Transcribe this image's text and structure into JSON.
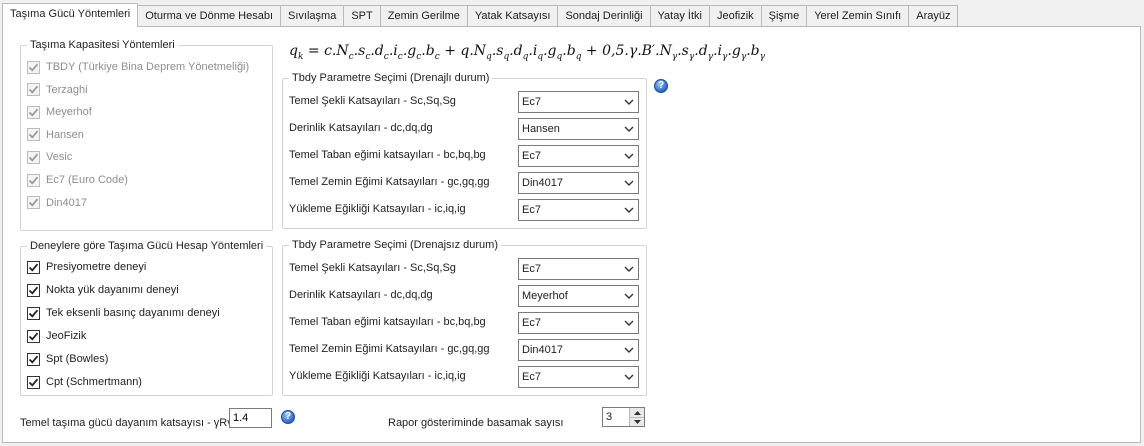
{
  "tabs": [
    {
      "label": "Taşıma Gücü Yöntemleri",
      "active": true
    },
    {
      "label": "Oturma ve Dönme Hesabı"
    },
    {
      "label": "Sıvılaşma"
    },
    {
      "label": "SPT"
    },
    {
      "label": "Zemin Gerilme"
    },
    {
      "label": "Yatak Katsayısı"
    },
    {
      "label": "Sondaj Derinliği"
    },
    {
      "label": "Yatay İtki"
    },
    {
      "label": "Jeofizik"
    },
    {
      "label": "Şişme"
    },
    {
      "label": "Yerel Zemin Sınıfı"
    },
    {
      "label": "Arayüz"
    }
  ],
  "capacity_methods": {
    "title": "Taşıma Kapasitesi Yöntemleri",
    "items": [
      {
        "label": "TBDY (Türkiye Bina Deprem Yönetmeliği)",
        "checked": true
      },
      {
        "label": "Terzaghi",
        "checked": true
      },
      {
        "label": "Meyerhof",
        "checked": true
      },
      {
        "label": "Hansen",
        "checked": true
      },
      {
        "label": "Vesic",
        "checked": true
      },
      {
        "label": "Ec7 (Euro Code)",
        "checked": true
      },
      {
        "label": "Din4017",
        "checked": true
      }
    ]
  },
  "test_methods": {
    "title": "Deneylere göre Taşıma Gücü Hesap Yöntemleri",
    "items": [
      {
        "label": "Presiyometre deneyi",
        "checked": true
      },
      {
        "label": "Nokta yük dayanımı deneyi",
        "checked": true
      },
      {
        "label": "Tek eksenli basınç dayanımı deneyi",
        "checked": true
      },
      {
        "label": "JeoFizik",
        "checked": true
      },
      {
        "label": "Spt (Bowles)",
        "checked": true
      },
      {
        "label": "Cpt (Schmertmann)",
        "checked": true
      }
    ]
  },
  "drained": {
    "title": "Tbdy Parametre Seçimi (Drenajlı durum)",
    "rows": [
      {
        "label": "Temel Şekli Katsayıları - Sc,Sq,Sg",
        "value": "Ec7"
      },
      {
        "label": "Derinlik Katsayıları - dc,dq,dg",
        "value": "Hansen"
      },
      {
        "label": "Temel Taban eğimi katsayıları - bc,bq,bg",
        "value": "Ec7"
      },
      {
        "label": "Temel Zemin Eğimi Katsayıları - gc,gq,gg",
        "value": "Din4017"
      },
      {
        "label": "Yükleme Eğikliği Katsayıları - ic,iq,ig",
        "value": "Ec7"
      }
    ]
  },
  "undrained": {
    "title": "Tbdy Parametre Seçimi  (Drenajsız durum)",
    "rows": [
      {
        "label": "Temel Şekli Katsayıları - Sc,Sq,Sg",
        "value": "Ec7"
      },
      {
        "label": "Derinlik Katsayıları - dc,dq,dg",
        "value": "Meyerhof"
      },
      {
        "label": "Temel Taban eğimi katsayıları - bc,bq,bg",
        "value": "Ec7"
      },
      {
        "label": "Temel Zemin Eğimi Katsayıları - gc,gq,gg",
        "value": "Din4017"
      },
      {
        "label": "Yükleme Eğikliği Katsayıları - ic,iq,ig",
        "value": "Ec7"
      }
    ]
  },
  "formula": {
    "lhs": "q",
    "lhs_sub": "k",
    "rhs": "= c.N_c.s_c.d_c.i_c.g_c.b_c + q.N_q.s_q.d_q.i_q.g_q.b_q + 0,5.γ.B′.N_γ.s_γ.d_γ.i_γ.g_γ.b_γ"
  },
  "bottom": {
    "resistance_label": "Temel taşıma gücü dayanım katsayısı - γRv",
    "resistance_value": "1.4",
    "digits_label": "Rapor gösteriminde basamak sayısı",
    "digits_value": "3"
  },
  "help_icon": "question-circle-icon",
  "colors": {
    "help_blue": "#2a66c2",
    "border": "#b9b9b9"
  }
}
